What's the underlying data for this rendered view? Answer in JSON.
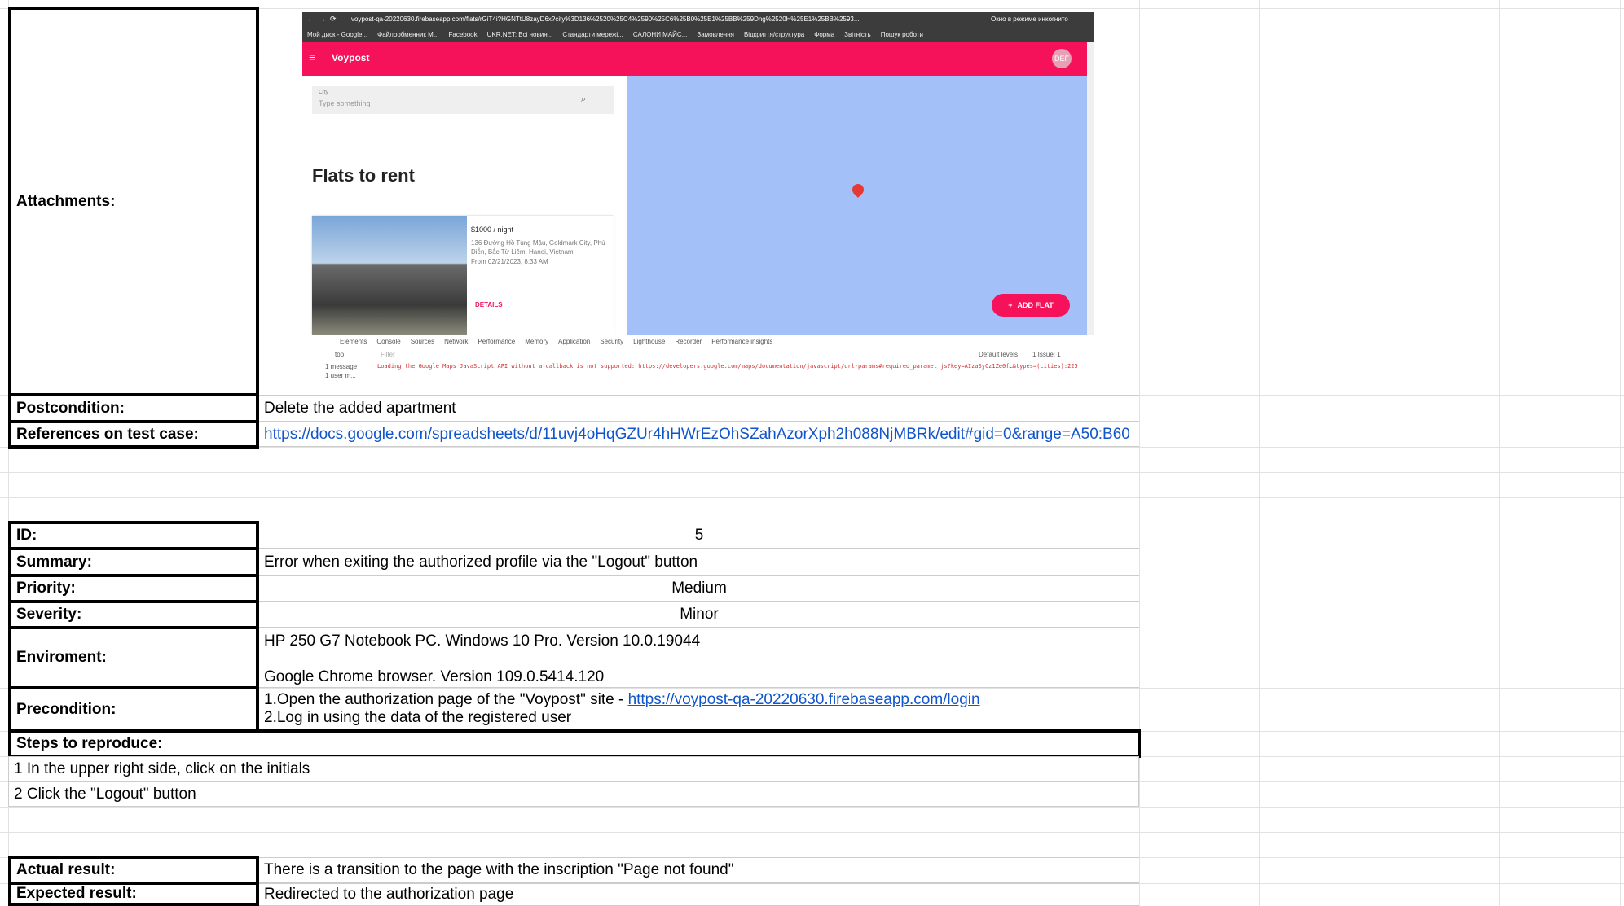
{
  "attachments": {
    "label": "Attachments:",
    "screenshot": {
      "url": "voypost-qa-20220630.firebaseapp.com/flats/rGiT4i?HGNTtU8zayD6x?city%3D136%2520%25C4%2590%25C6%25B0%25E1%25BB%259Dng%2520H%25E1%25BB%2593...",
      "incognito": "Окно в режиме инкогнито",
      "bookmarks": [
        "Мой диск - Google...",
        "Файлообменник M...",
        "Facebook",
        "UKR.NET: Всі новин...",
        "Стандарти мережі...",
        "САЛОНИ МАЙС...",
        "Замовлення",
        "Відкриття/структура",
        "Форма",
        "Звітність",
        "Пошук роботи"
      ],
      "app_title": "Voypost",
      "avatar": "DEF",
      "city_label": "City",
      "city_placeholder": "Type something",
      "heading": "Flats to rent",
      "price": "$1000 / night",
      "address": "136 Đường Hồ Tùng Mậu, Goldmark City, Phú Diễn, Bắc Từ Liêm, Hanoi, Vietnam",
      "from": "From 02/21/2023, 8:33 AM",
      "details": "DETAILS",
      "add_flat": "ADD FLAT",
      "devtools_tabs": [
        "Elements",
        "Console",
        "Sources",
        "Network",
        "Performance",
        "Memory",
        "Application",
        "Security",
        "Lighthouse",
        "Recorder",
        "Performance insights"
      ],
      "filter": "Filter",
      "top": "top",
      "default_levels": "Default levels",
      "issue": "1 Issue: 1",
      "side_msgs": [
        "1 message",
        "1 user m..."
      ],
      "error_text": "Loading the Google Maps JavaScript API without a callback is not supported: https://developers.google.com/maps/documentation/javascript/url-params#required_paramet  js?key=AIzaSyCz1Ze0f…&types=(cities):225"
    }
  },
  "postcondition": {
    "label": "Postcondition:",
    "value": "Delete the added apartment"
  },
  "references": {
    "label": "References on test case:",
    "value": "https://docs.google.com/spreadsheets/d/11uvj4oHqGZUr4hHWrEzOhSZahAzorXph2h088NjMBRk/edit#gid=0&range=A50:B60"
  },
  "id": {
    "label": "ID:",
    "value": "5"
  },
  "summary": {
    "label": "Summary:",
    "value": "Error when exiting the authorized profile via the \"Logout\" button"
  },
  "priority": {
    "label": "Priority:",
    "value": "Medium"
  },
  "severity": {
    "label": "Severity:",
    "value": "Minor"
  },
  "environment": {
    "label": "Enviroment:",
    "line1": "HP 250 G7 Notebook PC. Windows 10 Pro. Version 10.0.19044",
    "line2": "Google Chrome browser. Version 109.0.5414.120"
  },
  "precondition": {
    "label": "Precondition:",
    "line1_prefix": "1.Open the authorization page of the \"Voypost\" site - ",
    "line1_link": "https://voypost-qa-20220630.firebaseapp.com/login",
    "line2": "2.Log in using the data of the registered user"
  },
  "steps": {
    "label": "Steps to reproduce:",
    "items": [
      "1 In the upper right side, click on the initials",
      "2 Click the \"Logout\" button"
    ]
  },
  "actual": {
    "label": "Actual result:",
    "value": "There is a transition to the page with the inscription \"Page not found\""
  },
  "expected": {
    "label": "Expected result:",
    "value": "Redirected to the authorization page"
  }
}
